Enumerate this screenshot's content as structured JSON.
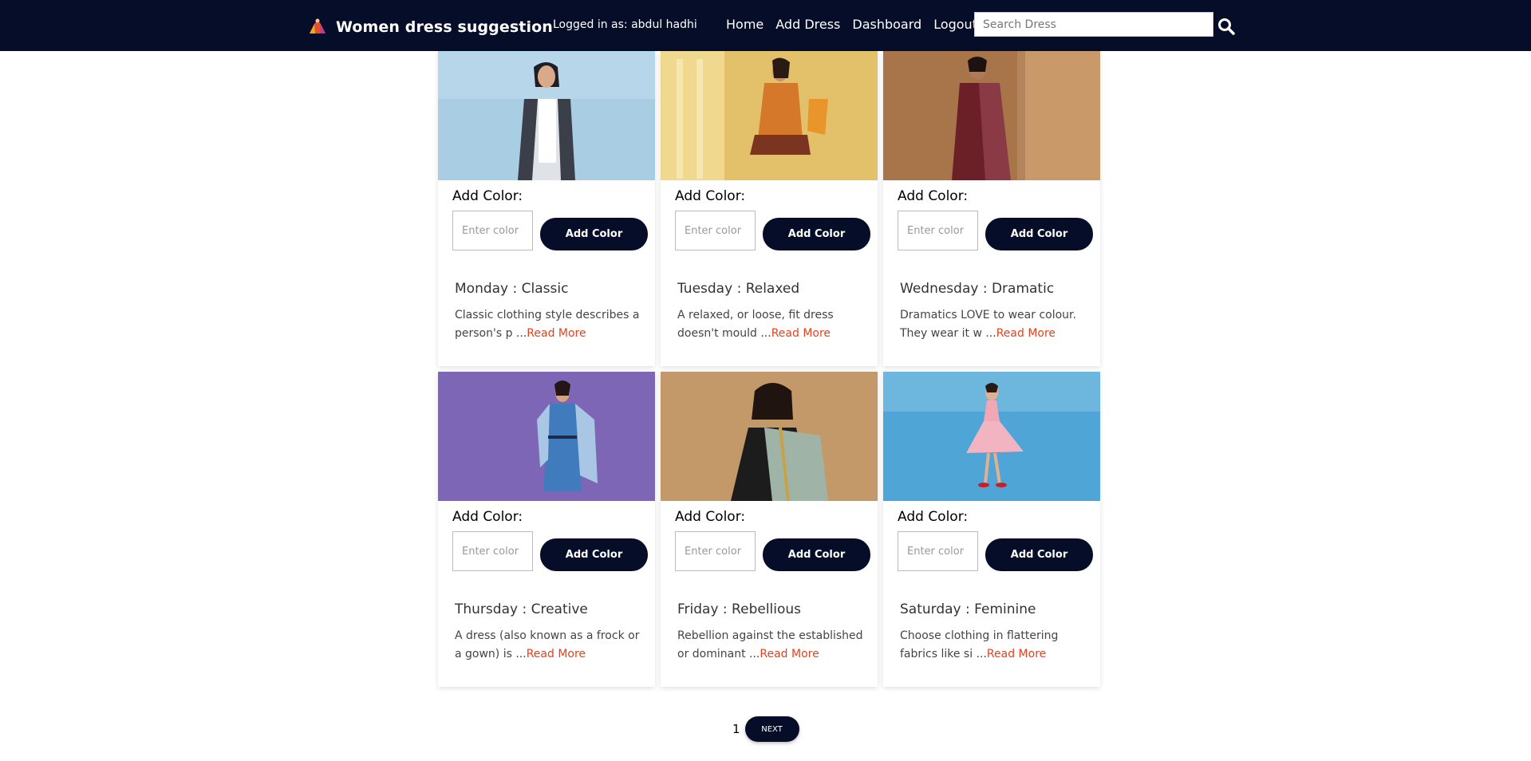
{
  "colors": {
    "navbar": "#050d28",
    "accent_button": "#050d28",
    "read_more": "#e8401c"
  },
  "navbar": {
    "brand": "Women dress suggestion",
    "brand_icon": "dress-logo-icon",
    "logged_in": "Logged in as: abdul hadhi",
    "links": [
      {
        "label": "Home"
      },
      {
        "label": "Add Dress"
      },
      {
        "label": "Dashboard"
      },
      {
        "label": "Logout"
      }
    ],
    "search": {
      "placeholder": "Search Dress",
      "value": "",
      "icon": "search-icon"
    }
  },
  "cards": [
    {
      "color_label": "Add Color:",
      "color_placeholder": "Enter color",
      "button": "Add Color",
      "title": "Monday : Classic",
      "excerpt": "Classic clothing style describes a person's p ...",
      "read_more": "Read More"
    },
    {
      "color_label": "Add Color:",
      "color_placeholder": "Enter color",
      "button": "Add Color",
      "title": "Tuesday : Relaxed",
      "excerpt": "A relaxed, or loose, fit dress doesn't mould ...",
      "read_more": "Read More"
    },
    {
      "color_label": "Add Color:",
      "color_placeholder": "Enter color",
      "button": "Add Color",
      "title": "Wednesday : Dramatic",
      "excerpt": "Dramatics LOVE to wear colour. They wear it w ...",
      "read_more": "Read More"
    },
    {
      "color_label": "Add Color:",
      "color_placeholder": "Enter color",
      "button": "Add Color",
      "title": "Thursday : Creative",
      "excerpt": "A dress (also known as a frock or a gown) is ...",
      "read_more": "Read More"
    },
    {
      "color_label": "Add Color:",
      "color_placeholder": "Enter color",
      "button": "Add Color",
      "title": "Friday : Rebellious",
      "excerpt": "Rebellion against the established or dominant ...",
      "read_more": "Read More"
    },
    {
      "color_label": "Add Color:",
      "color_placeholder": "Enter color",
      "button": "Add Color",
      "title": "Saturday : Feminine",
      "excerpt": "Choose clothing in flattering fabrics like si ...",
      "read_more": "Read More"
    }
  ],
  "pagination": {
    "current": "1",
    "next": "NEXT"
  }
}
